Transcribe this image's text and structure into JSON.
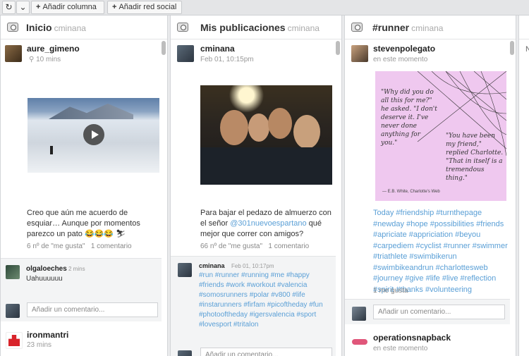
{
  "toolbar": {
    "refresh_icon": "refresh-icon",
    "dropdown_icon": "chevron-down-icon",
    "add_column": "Añadir columna",
    "add_network": "Añadir red social"
  },
  "streams": [
    {
      "title": "Inicio",
      "account": "cminana",
      "posts": [
        {
          "user": "aure_gimeno",
          "time": "10 mins",
          "text": "Creo que aún me acuerdo de esquiar… Aunque por momentos parezco un pato 😂😂😂 ⛷",
          "likes": "6 nº de \"me gusta\"",
          "comments_link": "1 comentario",
          "comment": {
            "user": "olgaloeches",
            "time": "2 mins",
            "text": "Uahuuuuuu"
          },
          "comment_placeholder": "Añadir un comentario..."
        },
        {
          "user": "ironmantri",
          "time": "23 mins"
        }
      ]
    },
    {
      "title": "Mis publicaciones",
      "account": "cminana",
      "posts": [
        {
          "user": "cminana",
          "time": "Feb 01, 10:15pm",
          "text_before": "Para bajar el pedazo de almuerzo con el señor ",
          "mention": "@301nuevoespartano",
          "text_after": " qué mejor que correr con amigos?",
          "likes": "66 nº de \"me gusta\"",
          "comments_link": "1 comentario",
          "comment": {
            "user": "cminana",
            "time": "Feb 01, 10:17pm",
            "text": "#run #runner #running #me #happy #friends #work #workout #valencia #somosrunners #polar #v800 #life #instarunners #firfam #picoftheday #fun #photooftheday #igersvalencia #sport #lovesport #tritalon"
          },
          "comment_placeholder": "Añadir un comentario..."
        }
      ]
    },
    {
      "title": "#runner",
      "account": "cminana",
      "posts": [
        {
          "user": "stevenpolegato",
          "time": "en este momento",
          "quote_left": "\"Why did you do all this for me?\" he asked. \"I don't deserve it. I've never done anything for you.\"",
          "quote_right": "\"You have been my friend,\" replied Charlotte. \"That in itself is a tremendous thing.\"",
          "quote_source": "— E.B. White, Charlotte's Web",
          "text": "Today #friendship #turnthepage #newday #hope #possibilities #friends #apriciate #appriciation #beyou #carpediem #cyclist #runner #swimmer #triathlete #swimbikerun #swimbikeandrun #charlottesweb #journey #give #life #live #reflection #spirit #thanks #volunteering",
          "likes": "1 me gusta",
          "comment_placeholder": "Añadir un comentario..."
        },
        {
          "user": "operationsnapback",
          "time": "en este momento"
        }
      ]
    },
    {
      "partial_text": "N"
    }
  ]
}
